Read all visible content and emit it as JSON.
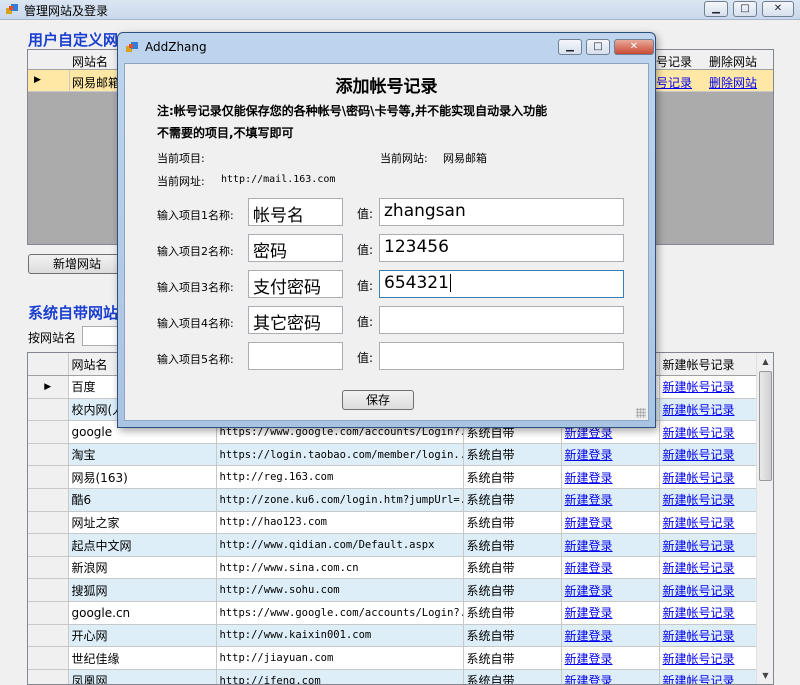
{
  "main": {
    "title": "管理网站及登录",
    "controls": {
      "minimize": "▁",
      "maximize": "□",
      "close": "✕"
    },
    "user_section_title": "用户自定义网",
    "user_grid": {
      "headers": [
        "网站名",
        "号记录",
        "删除网站"
      ],
      "row": {
        "site": "网易邮箱",
        "add_record": "号记录",
        "delete": "删除网站"
      }
    },
    "add_site_button": "新增网站",
    "system_section_title": "系统自带网站",
    "search_label": "按网站名",
    "system_grid": {
      "headers": {
        "name": "网站名",
        "new_record": "新建帐号记录"
      },
      "rows": [
        {
          "name": "百度",
          "url": "",
          "type": "",
          "login": "",
          "record": "新建帐号记录"
        },
        {
          "name": "校内网(人",
          "url": "",
          "type": "",
          "login": "",
          "record": "新建帐号记录"
        },
        {
          "name": "google",
          "url": "https://www.google.com/accounts/Login?...",
          "type": "系统自带",
          "login": "新建登录",
          "record": "新建帐号记录"
        },
        {
          "name": "淘宝",
          "url": "https://login.taobao.com/member/login....",
          "type": "系统自带",
          "login": "新建登录",
          "record": "新建帐号记录"
        },
        {
          "name": "网易(163)",
          "url": "http://reg.163.com",
          "type": "系统自带",
          "login": "新建登录",
          "record": "新建帐号记录"
        },
        {
          "name": "酷6",
          "url": "http://zone.ku6.com/login.htm?jumpUrl=...",
          "type": "系统自带",
          "login": "新建登录",
          "record": "新建帐号记录"
        },
        {
          "name": "网址之家",
          "url": "http://hao123.com",
          "type": "系统自带",
          "login": "新建登录",
          "record": "新建帐号记录"
        },
        {
          "name": "起点中文网",
          "url": "http://www.qidian.com/Default.aspx",
          "type": "系统自带",
          "login": "新建登录",
          "record": "新建帐号记录"
        },
        {
          "name": "新浪网",
          "url": "http://www.sina.com.cn",
          "type": "系统自带",
          "login": "新建登录",
          "record": "新建帐号记录"
        },
        {
          "name": "搜狐网",
          "url": "http://www.sohu.com",
          "type": "系统自带",
          "login": "新建登录",
          "record": "新建帐号记录"
        },
        {
          "name": "google.cn",
          "url": "https://www.google.com/accounts/Login?...",
          "type": "系统自带",
          "login": "新建登录",
          "record": "新建帐号记录"
        },
        {
          "name": "开心网",
          "url": "http://www.kaixin001.com",
          "type": "系统自带",
          "login": "新建登录",
          "record": "新建帐号记录"
        },
        {
          "name": "世纪佳缘",
          "url": "http://jiayuan.com",
          "type": "系统自带",
          "login": "新建登录",
          "record": "新建帐号记录"
        },
        {
          "name": "凤凰网",
          "url": "http://ifeng.com",
          "type": "系统自带",
          "login": "新建登录",
          "record": "新建帐号记录"
        }
      ]
    }
  },
  "dialog": {
    "title": "AddZhang",
    "heading": "添加帐号记录",
    "note1": "注:帐号记录仅能保存您的各种帐号\\密码\\卡号等,并不能实现自动录入功能",
    "note2": "不需要的项目,不填写即可",
    "current_item_label": "当前项目:",
    "current_site_label": "当前网站:",
    "current_site_value": "网易邮箱",
    "current_url_label": "当前网址:",
    "current_url_value": "http://mail.163.com",
    "value_label": "值:",
    "items": [
      {
        "label": "输入项目1名称:",
        "name": "帐号名",
        "value": "zhangsan"
      },
      {
        "label": "输入项目2名称:",
        "name": "密码",
        "value": "123456"
      },
      {
        "label": "输入项目3名称:",
        "name": "支付密码",
        "value": "654321"
      },
      {
        "label": "输入项目4名称:",
        "name": "其它密码",
        "value": ""
      },
      {
        "label": "输入项目5名称:",
        "name": "",
        "value": ""
      }
    ],
    "save_button": "保存"
  },
  "colors": {
    "section_title": "#1a3fd0",
    "selected_row": "#ffe8a6",
    "alt_row": "#ddeef8",
    "link": "#0000ee"
  }
}
